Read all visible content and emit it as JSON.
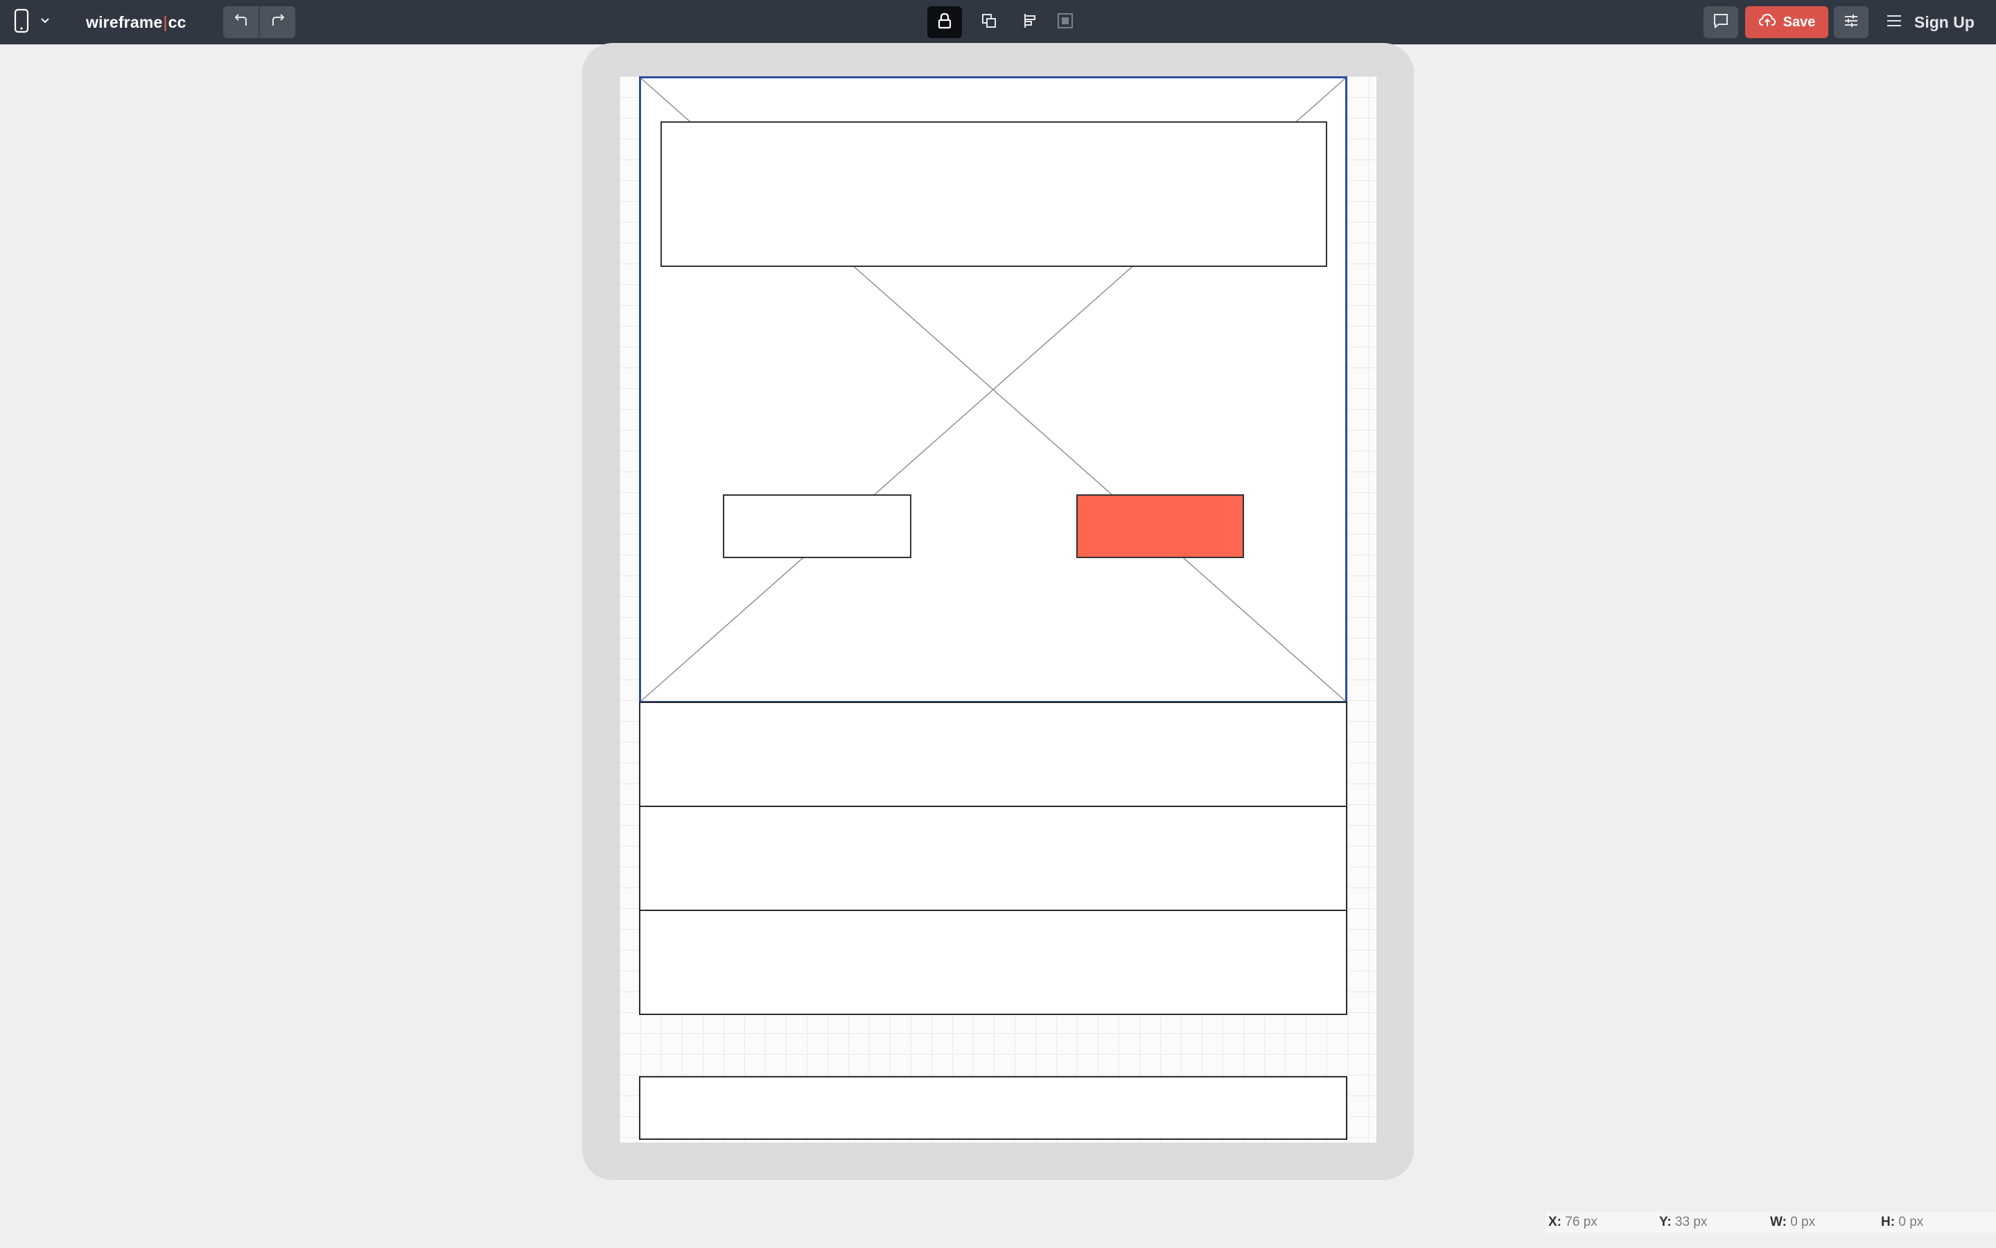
{
  "app": {
    "brand_left": "wireframe",
    "brand_sep": "|",
    "brand_right": "cc"
  },
  "toolbar": {
    "device_icon": "mobile-device-icon",
    "undo_icon": "undo-icon",
    "redo_icon": "redo-icon",
    "tools": [
      {
        "name": "lock",
        "icon": "lock-icon",
        "active": true
      },
      {
        "name": "bring-forward",
        "icon": "layers-icon",
        "active": false
      },
      {
        "name": "align",
        "icon": "align-icon",
        "active": false
      },
      {
        "name": "group",
        "icon": "group-icon",
        "active": false
      }
    ],
    "save_label": "Save",
    "signup_label": "Sign Up"
  },
  "colors": {
    "topbar": "#313742",
    "save": "#d9534b",
    "accent_red": "#ff664f",
    "selection": "#2c4fa0"
  },
  "status": {
    "x_label": "X:",
    "x_value": "76 px",
    "y_label": "Y:",
    "y_value": "33 px",
    "w_label": "W:",
    "w_value": "0 px",
    "h_label": "H:",
    "h_value": "0 px"
  }
}
